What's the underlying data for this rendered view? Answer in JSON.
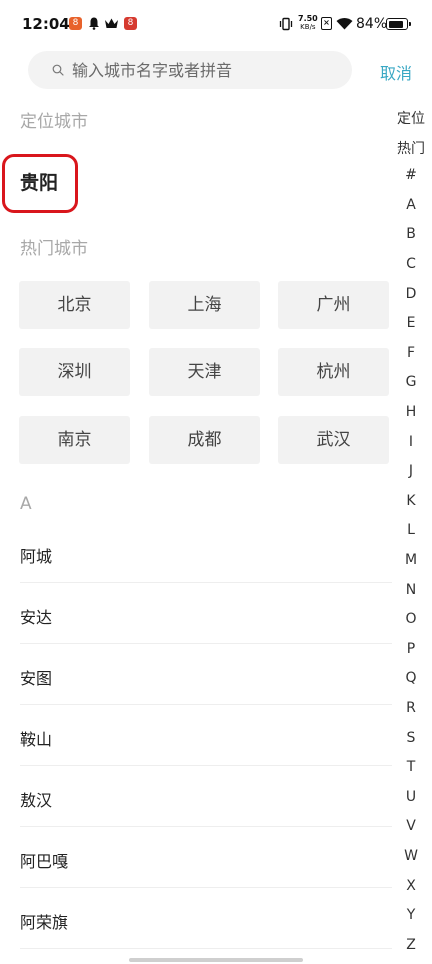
{
  "status_bar": {
    "time": "12:04",
    "net_speed_value": "7.50",
    "net_speed_unit": "KB/s",
    "battery_percent": "84%",
    "battery_level": 0.84,
    "badge1_text": "8",
    "badge2_text": "8"
  },
  "search": {
    "placeholder": "输入城市名字或者拼音",
    "value": "",
    "cancel_label": "取消"
  },
  "located_section": {
    "title": "定位城市",
    "city": "贵阳"
  },
  "hot_section": {
    "title": "热门城市",
    "cities": [
      "北京",
      "上海",
      "广州",
      "深圳",
      "天津",
      "杭州",
      "南京",
      "成都",
      "武汉"
    ]
  },
  "city_list": {
    "header": "A",
    "cities": [
      "阿城",
      "安达",
      "安图",
      "鞍山",
      "敖汉",
      "阿巴嘎",
      "阿荣旗"
    ]
  },
  "side_index": {
    "items": [
      "定位",
      "热门",
      "#",
      "A",
      "B",
      "C",
      "D",
      "E",
      "F",
      "G",
      "H",
      "I",
      "J",
      "K",
      "L",
      "M",
      "N",
      "O",
      "P",
      "Q",
      "R",
      "S",
      "T",
      "U",
      "V",
      "W",
      "X",
      "Y",
      "Z"
    ]
  },
  "colors": {
    "accent": "#3aa8c4",
    "highlight": "#d9161c",
    "section_title": "#a8a8a8"
  }
}
